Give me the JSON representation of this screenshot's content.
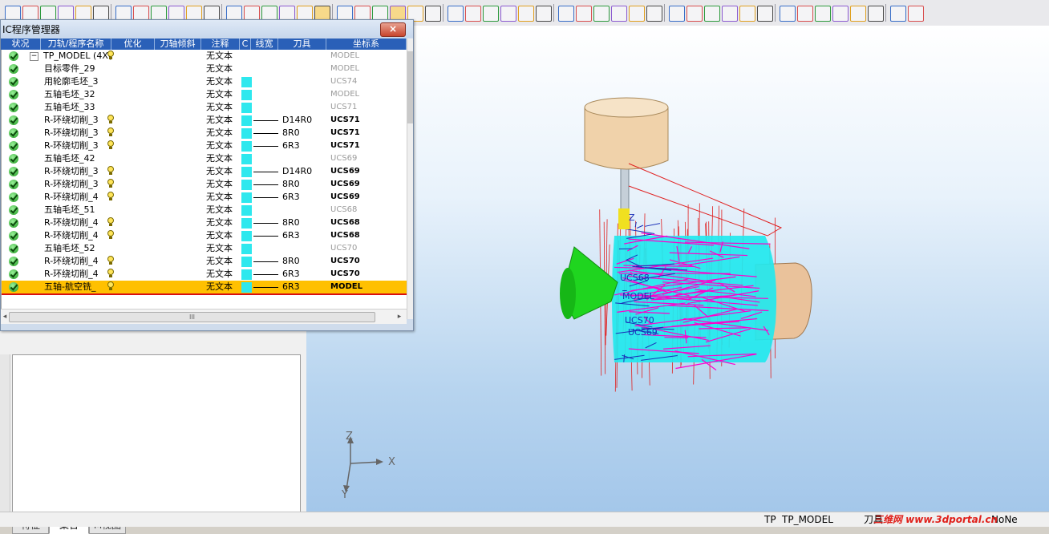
{
  "dialog": {
    "title": "IC程序管理器",
    "close_label": "×",
    "columns": [
      "状况",
      "刀轨/程序名称",
      "优化",
      "刀轴倾斜",
      "注释",
      "C",
      "线宽",
      "刀具",
      "坐标系"
    ],
    "rows": [
      {
        "name": "TP_MODEL (4X(",
        "note": "无文本",
        "tool": "",
        "cs": "MODEL",
        "bulb": true,
        "swatch": false,
        "line": false,
        "cs_style": "dim",
        "expander": "−",
        "indent": false,
        "selected": false
      },
      {
        "name": "目标零件_29",
        "note": "无文本",
        "tool": "",
        "cs": "MODEL",
        "bulb": false,
        "swatch": false,
        "line": false,
        "cs_style": "dim",
        "indent": true,
        "selected": false
      },
      {
        "name": "用轮廓毛坯_3",
        "note": "无文本",
        "tool": "",
        "cs": "UCS74",
        "bulb": false,
        "swatch": true,
        "line": false,
        "cs_style": "dim",
        "indent": true,
        "selected": false
      },
      {
        "name": "五轴毛坯_32",
        "note": "无文本",
        "tool": "",
        "cs": "MODEL",
        "bulb": false,
        "swatch": true,
        "line": false,
        "cs_style": "dim",
        "indent": true,
        "selected": false
      },
      {
        "name": "五轴毛坯_33",
        "note": "无文本",
        "tool": "",
        "cs": "UCS71",
        "bulb": false,
        "swatch": true,
        "line": false,
        "cs_style": "dim",
        "indent": true,
        "selected": false
      },
      {
        "name": "R-环绕切削_3",
        "note": "无文本",
        "tool": "D14R0",
        "cs": "UCS71",
        "bulb": true,
        "swatch": true,
        "line": true,
        "cs_style": "bold",
        "indent": true,
        "selected": false
      },
      {
        "name": "R-环绕切削_3",
        "note": "无文本",
        "tool": "8R0",
        "cs": "UCS71",
        "bulb": true,
        "swatch": true,
        "line": true,
        "cs_style": "bold",
        "indent": true,
        "selected": false
      },
      {
        "name": "R-环绕切削_3",
        "note": "无文本",
        "tool": "6R3",
        "cs": "UCS71",
        "bulb": true,
        "swatch": true,
        "line": true,
        "cs_style": "bold",
        "indent": true,
        "selected": false
      },
      {
        "name": "五轴毛坯_42",
        "note": "无文本",
        "tool": "",
        "cs": "UCS69",
        "bulb": false,
        "swatch": true,
        "line": false,
        "cs_style": "dim",
        "indent": true,
        "selected": false
      },
      {
        "name": "R-环绕切削_3",
        "note": "无文本",
        "tool": "D14R0",
        "cs": "UCS69",
        "bulb": true,
        "swatch": true,
        "line": true,
        "cs_style": "bold",
        "indent": true,
        "selected": false
      },
      {
        "name": "R-环绕切削_3",
        "note": "无文本",
        "tool": "8R0",
        "cs": "UCS69",
        "bulb": true,
        "swatch": true,
        "line": true,
        "cs_style": "bold",
        "indent": true,
        "selected": false
      },
      {
        "name": "R-环绕切削_4",
        "note": "无文本",
        "tool": "6R3",
        "cs": "UCS69",
        "bulb": true,
        "swatch": true,
        "line": true,
        "cs_style": "bold",
        "indent": true,
        "selected": false
      },
      {
        "name": "五轴毛坯_51",
        "note": "无文本",
        "tool": "",
        "cs": "UCS68",
        "bulb": false,
        "swatch": true,
        "line": false,
        "cs_style": "dim",
        "indent": true,
        "selected": false
      },
      {
        "name": "R-环绕切削_4",
        "note": "无文本",
        "tool": "8R0",
        "cs": "UCS68",
        "bulb": true,
        "swatch": true,
        "line": true,
        "cs_style": "bold",
        "indent": true,
        "selected": false
      },
      {
        "name": "R-环绕切削_4",
        "note": "无文本",
        "tool": "6R3",
        "cs": "UCS68",
        "bulb": true,
        "swatch": true,
        "line": true,
        "cs_style": "bold",
        "indent": true,
        "selected": false
      },
      {
        "name": "五轴毛坯_52",
        "note": "无文本",
        "tool": "",
        "cs": "UCS70",
        "bulb": false,
        "swatch": true,
        "line": false,
        "cs_style": "dim",
        "indent": true,
        "selected": false
      },
      {
        "name": "R-环绕切削_4",
        "note": "无文本",
        "tool": "8R0",
        "cs": "UCS70",
        "bulb": true,
        "swatch": true,
        "line": true,
        "cs_style": "bold",
        "indent": true,
        "selected": false
      },
      {
        "name": "R-环绕切削_4",
        "note": "无文本",
        "tool": "6R3",
        "cs": "UCS70",
        "bulb": true,
        "swatch": true,
        "line": true,
        "cs_style": "bold",
        "indent": true,
        "selected": false
      },
      {
        "name": "五轴-航空铣_",
        "note": "无文本",
        "tool": "6R3",
        "cs": "MODEL",
        "bulb": true,
        "swatch": true,
        "line": true,
        "cs_style": "bold",
        "indent": true,
        "selected": true
      }
    ],
    "hscroll_grip": "III"
  },
  "left_panel": {
    "tabs": [
      "特征",
      "集合",
      "M视图"
    ],
    "active_tab": "集合"
  },
  "viewport": {
    "axis_z": "Z",
    "axis_x": "X",
    "axis_y": "Y",
    "labels": [
      "Z",
      "UCS68",
      "MODEL",
      "UCS70",
      "UCS69"
    ]
  },
  "statusbar": {
    "tp_label": "TP",
    "tp_value": "TP_MODEL",
    "tool_label": "刀具",
    "right_text": "NoNe",
    "watermark": "三维网 www.3dportal.cn"
  },
  "colors": {
    "header_bg": "#2a60b8",
    "swatch": "#2ee8ee",
    "selected_row": "#ffc000",
    "toolpath": "#ff00cc",
    "stock": "#22e8ee",
    "cone": "#1fd51f",
    "holder": "#f0d2aa"
  }
}
